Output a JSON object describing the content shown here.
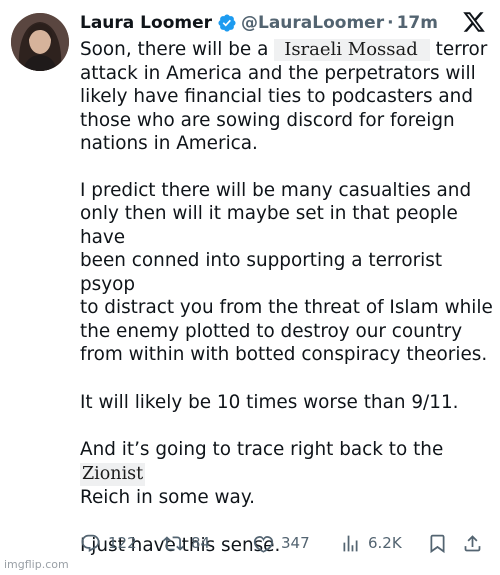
{
  "author": {
    "name": "Laura Loomer",
    "handle": "@LauraLoomer",
    "separator": "·",
    "time": "17m"
  },
  "tweet": {
    "p1_before": "Soon, there will be a",
    "p1_redacted": "Israeli Mossad",
    "p1_after_line1": "terror",
    "p1_lines": [
      "attack in America and the perpetrators will",
      "likely have financial ties to podcasters and",
      "those who are sowing discord for foreign",
      "nations in America."
    ],
    "p2_lines": [
      "I predict there will be many casualties and",
      "only then will it maybe set in that people have",
      "been conned into supporting a terrorist psyop",
      "to distract you from the threat of Islam while",
      "the enemy plotted to destroy our country",
      "from within with botted conspiracy theories."
    ],
    "p3": "It will likely be 10 times worse than 9/11.",
    "p4_before": "And it’s going to trace right back to the",
    "p4_redacted": "Zionist",
    "p4_line2": "Reich in some way.",
    "p5": "I just have this sense."
  },
  "actions": {
    "replies": "122",
    "reposts": "84",
    "likes": "347",
    "views": "6.2K"
  },
  "watermark": "imgflip.com",
  "colors": {
    "text": "#0f1419",
    "secondary": "#536471",
    "verified": "#1d9bf0"
  },
  "icons": [
    "verified-badge-icon",
    "x-logo-icon",
    "reply-icon",
    "repost-icon",
    "like-icon",
    "views-icon",
    "bookmark-icon",
    "share-icon"
  ]
}
